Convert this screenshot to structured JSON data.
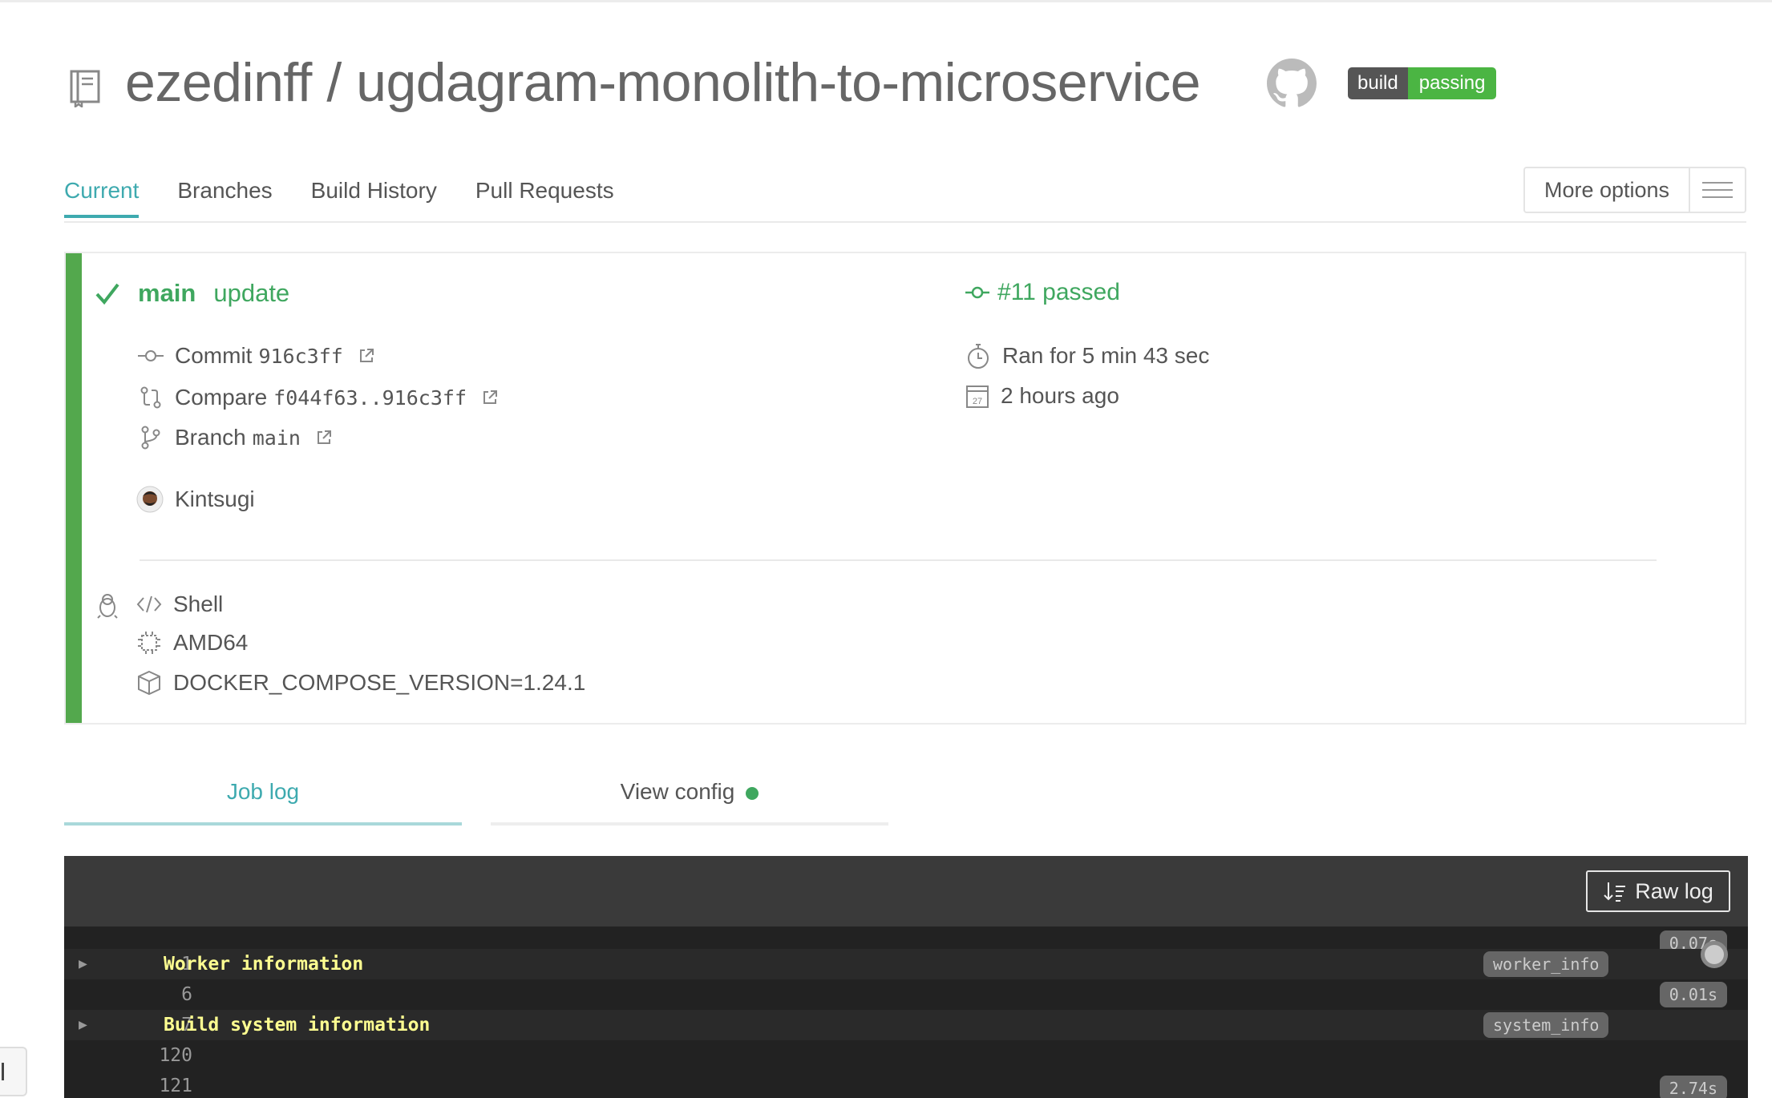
{
  "repo": {
    "owner": "ezedinff",
    "separator": "/",
    "name": "ugdagram-monolith-to-microservice",
    "badge": {
      "left": "build",
      "right": "passing"
    }
  },
  "tabs": [
    {
      "label": "Current",
      "active": true
    },
    {
      "label": "Branches"
    },
    {
      "label": "Build History"
    },
    {
      "label": "Pull Requests"
    }
  ],
  "more_options": {
    "label": "More options"
  },
  "build": {
    "status_color": "#53a84d",
    "branch": "main",
    "message": "update",
    "number": "#11 passed",
    "commit": {
      "label": "Commit",
      "hash": "916c3ff"
    },
    "compare": {
      "label": "Compare",
      "range": "f044f63..916c3ff"
    },
    "branch_info": {
      "label": "Branch",
      "name": "main"
    },
    "author": "Kintsugi",
    "duration": "Ran for 5 min 43 sec",
    "finished": "2 hours ago",
    "calendar_day": "27",
    "language": "Shell",
    "arch": "AMD64",
    "env": "DOCKER_COMPOSE_VERSION=1.24.1"
  },
  "log_tabs": {
    "job_log": "Job log",
    "view_config": "View config"
  },
  "log": {
    "raw_log": "Raw log",
    "lines": [
      {
        "num": "1",
        "text": "Worker information",
        "tag": "worker_info",
        "time": "0.07s",
        "foldable": true
      },
      {
        "num": "6",
        "text": "",
        "time": "0.01s"
      },
      {
        "num": "7",
        "text": "Build system information",
        "tag": "system_info",
        "foldable": true
      },
      {
        "num": "120",
        "text": ""
      },
      {
        "num": "121",
        "text": "",
        "time": "2.74s"
      }
    ]
  }
}
